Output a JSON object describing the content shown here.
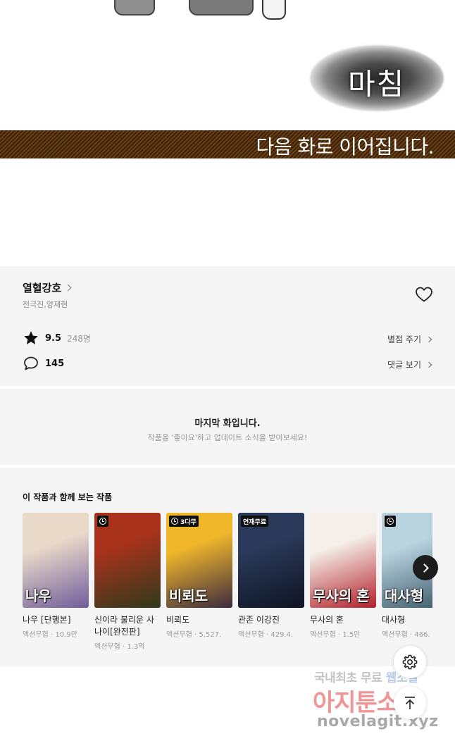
{
  "comic": {
    "end_word": "마침",
    "banner_text": "다음 화로 이어집니다."
  },
  "work": {
    "title": "열혈강호",
    "authors": "전극진,양재현",
    "rating": "9.5",
    "rating_count": "248명",
    "rate_action": "별점 주기",
    "comment_count": "145",
    "comment_action": "댓글 보기"
  },
  "last_episode": {
    "title": "마지막 화입니다.",
    "subtitle": "작품을 '좋아요'하고 업데이트 소식을 받아보세요!"
  },
  "recommendations": {
    "heading": "이 작품과 함께 보는 작품",
    "items": [
      {
        "name": "나우 [단행본]",
        "meta": "액션무협 · 10.9만",
        "cover_text": "나우",
        "badge": "",
        "badge_clock": false,
        "palette": [
          "#e9d9c9",
          "#6f5d9b"
        ]
      },
      {
        "name": "신이라 불리운 사나이[완전판]",
        "meta": "액션무협 · 1.3억",
        "cover_text": "",
        "badge": "",
        "badge_clock": true,
        "palette": [
          "#a8321c",
          "#2f3a1b"
        ]
      },
      {
        "name": "비뢰도",
        "meta": "액션무협 · 5,527.",
        "cover_text": "비뢰도",
        "badge": "3다무",
        "badge_clock": true,
        "palette": [
          "#f0b72a",
          "#3b2a3e"
        ]
      },
      {
        "name": "관존 이강진",
        "meta": "액션무협 · 429.4.",
        "cover_text": "",
        "badge": "연재무료",
        "badge_clock": false,
        "palette": [
          "#2b3a5a",
          "#0e1422"
        ]
      },
      {
        "name": "무사의 혼",
        "meta": "액션무협 · 1.5만",
        "cover_text": "무사의 혼",
        "badge": "",
        "badge_clock": false,
        "palette": [
          "#f4efe8",
          "#b3202a"
        ]
      },
      {
        "name": "대사형",
        "meta": "액션무협 · 466.",
        "cover_text": "대사형",
        "badge": "",
        "badge_clock": true,
        "palette": [
          "#b9d3df",
          "#3e5a6a"
        ]
      }
    ]
  },
  "watermark": {
    "line1_a": "국내최초 무료 ",
    "line1_b": "웹소설",
    "line2": "아지툰소설",
    "line3": "novelagit.xyz"
  },
  "icons": {
    "like": "heart-icon",
    "rating": "star-icon",
    "comment": "comment-icon",
    "settings": "gear-icon",
    "scroll_top": "arrow-up-icon",
    "next": "chevron-right-icon"
  }
}
